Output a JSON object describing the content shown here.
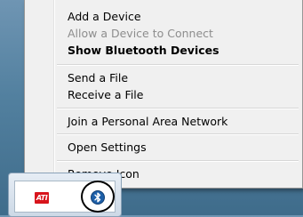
{
  "context_menu": {
    "items": [
      {
        "label": "Add a Device",
        "enabled": true,
        "bold": false
      },
      {
        "label": "Allow a Device to Connect",
        "enabled": false,
        "bold": false
      },
      {
        "label": "Show Bluetooth Devices",
        "enabled": true,
        "bold": true
      },
      {
        "label": "Send a File",
        "enabled": true,
        "bold": false
      },
      {
        "label": "Receive a File",
        "enabled": true,
        "bold": false
      },
      {
        "label": "Join a Personal Area Network",
        "enabled": true,
        "bold": false
      },
      {
        "label": "Open Settings",
        "enabled": true,
        "bold": false
      },
      {
        "label": "Remove Icon",
        "enabled": true,
        "bold": false
      }
    ]
  },
  "tray": {
    "icons": [
      {
        "name": "ati-icon",
        "text": "ATI",
        "color": "#d8141c"
      },
      {
        "name": "bluetooth-icon",
        "color": "#1d5fa8",
        "highlighted": true
      }
    ]
  },
  "colors": {
    "menu_background": "#f0f0f0",
    "disabled_text": "#8d8d8d",
    "desktop": "#52809f"
  }
}
